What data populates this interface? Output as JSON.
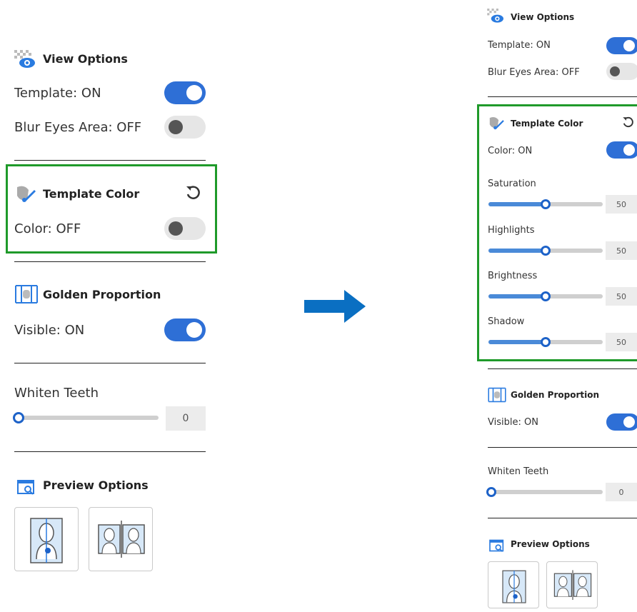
{
  "colors": {
    "accent": "#2e6fd6",
    "highlight": "#1f9a2a",
    "arrow": "#0a6fc2"
  },
  "before": {
    "view_options": {
      "title": "View Options",
      "icon": "view-eye-icon",
      "template": {
        "label": "Template: ON",
        "state": "on"
      },
      "blur_eyes": {
        "label": "Blur Eyes Area: OFF",
        "state": "off"
      }
    },
    "template_color": {
      "title": "Template Color",
      "icon": "paint-brush-icon",
      "reset_icon": "reset-icon",
      "color": {
        "label": "Color: OFF",
        "state": "off"
      }
    },
    "golden_proportion": {
      "title": "Golden Proportion",
      "icon": "golden-proportion-icon",
      "visible": {
        "label": "Visible: ON",
        "state": "on"
      }
    },
    "whiten_teeth": {
      "title": "Whiten Teeth",
      "value": "0"
    },
    "preview_options": {
      "title": "Preview Options",
      "icon": "preview-icon"
    }
  },
  "after": {
    "view_options": {
      "title": "View Options",
      "template": {
        "label": "Template: ON",
        "state": "on"
      },
      "blur_eyes": {
        "label": "Blur Eyes Area: OFF",
        "state": "off"
      }
    },
    "template_color": {
      "title": "Template Color",
      "color": {
        "label": "Color: ON",
        "state": "on"
      },
      "sliders": [
        {
          "label": "Saturation",
          "value": "50"
        },
        {
          "label": "Highlights",
          "value": "50"
        },
        {
          "label": "Brightness",
          "value": "50"
        },
        {
          "label": "Shadow",
          "value": "50"
        }
      ]
    },
    "golden_proportion": {
      "title": "Golden Proportion",
      "visible": {
        "label": "Visible: ON",
        "state": "on"
      }
    },
    "whiten_teeth": {
      "title": "Whiten Teeth",
      "value": "0"
    },
    "preview_options": {
      "title": "Preview Options"
    }
  }
}
